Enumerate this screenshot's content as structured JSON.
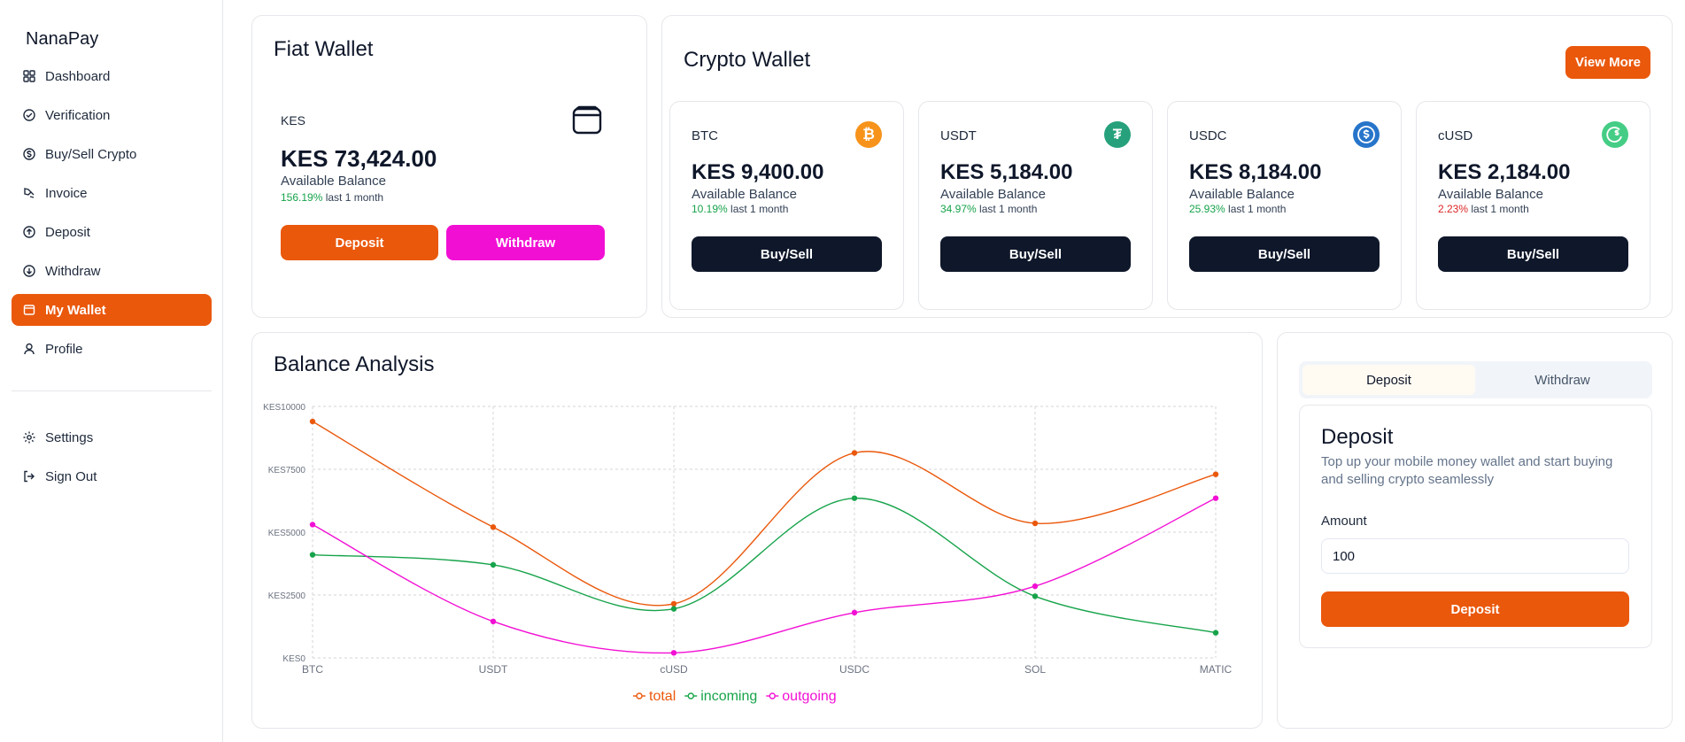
{
  "brand": "NanaPay",
  "sidebar": {
    "items": [
      {
        "label": "Dashboard",
        "icon": "grid-icon"
      },
      {
        "label": "Verification",
        "icon": "check-circle-icon"
      },
      {
        "label": "Buy/Sell Crypto",
        "icon": "dollar-circle-icon"
      },
      {
        "label": "Invoice",
        "icon": "invoice-icon"
      },
      {
        "label": "Deposit",
        "icon": "arrow-up-circle-icon"
      },
      {
        "label": "Withdraw",
        "icon": "arrow-down-circle-icon"
      },
      {
        "label": "My Wallet",
        "icon": "wallet-icon",
        "active": true
      },
      {
        "label": "Profile",
        "icon": "user-icon"
      }
    ],
    "footer_items": [
      {
        "label": "Settings",
        "icon": "gear-icon"
      },
      {
        "label": "Sign Out",
        "icon": "sign-out-icon"
      }
    ]
  },
  "fiat": {
    "title": "Fiat Wallet",
    "currency": "KES",
    "amount": "KES 73,424.00",
    "available_label": "Available Balance",
    "change": "156.19%",
    "period": "last 1 month",
    "deposit_label": "Deposit",
    "withdraw_label": "Withdraw"
  },
  "crypto": {
    "title": "Crypto Wallet",
    "view_more": "View More",
    "coins": [
      {
        "symbol": "BTC",
        "amount": "KES 9,400.00",
        "available_label": "Available Balance",
        "change": "10.19%",
        "trend": "up",
        "period": "last 1 month",
        "action": "Buy/Sell",
        "icon": "bitcoin-icon",
        "color": "#f7931a"
      },
      {
        "symbol": "USDT",
        "amount": "KES 5,184.00",
        "available_label": "Available Balance",
        "change": "34.97%",
        "trend": "up",
        "period": "last 1 month",
        "action": "Buy/Sell",
        "icon": "tether-icon",
        "color": "#26a17b"
      },
      {
        "symbol": "USDC",
        "amount": "KES 8,184.00",
        "available_label": "Available Balance",
        "change": "25.93%",
        "trend": "up",
        "period": "last 1 month",
        "action": "Buy/Sell",
        "icon": "usdc-icon",
        "color": "#2775ca"
      },
      {
        "symbol": "cUSD",
        "amount": "KES 2,184.00",
        "available_label": "Available Balance",
        "change": "2.23%",
        "trend": "down",
        "period": "last 1 month",
        "action": "Buy/Sell",
        "icon": "cusd-icon",
        "color": "#45cd85"
      }
    ]
  },
  "analysis": {
    "title": "Balance Analysis"
  },
  "chart_data": {
    "type": "line",
    "categories": [
      "BTC",
      "USDT",
      "cUSD",
      "USDC",
      "SOL",
      "MATIC"
    ],
    "y_ticks": [
      "KES0",
      "KES2500",
      "KES5000",
      "KES7500",
      "KES10000"
    ],
    "ylim": [
      0,
      10000
    ],
    "grid": true,
    "legend_position": "bottom-center",
    "series": [
      {
        "name": "total",
        "color": "#ea580c",
        "values": [
          9400,
          5200,
          2150,
          8150,
          5350,
          7300
        ]
      },
      {
        "name": "incoming",
        "color": "#16a34a",
        "values": [
          4100,
          3700,
          1950,
          6350,
          2450,
          1000
        ]
      },
      {
        "name": "outgoing",
        "color": "#f20fd4",
        "values": [
          5300,
          1450,
          200,
          1800,
          2850,
          6350
        ]
      }
    ]
  },
  "deposit_panel": {
    "tabs": [
      "Deposit",
      "Withdraw"
    ],
    "active_tab": "Deposit",
    "heading": "Deposit",
    "description": "Top up your mobile money wallet and start buying and selling crypto seamlessly",
    "amount_label": "Amount",
    "amount_value": "100",
    "submit_label": "Deposit"
  }
}
